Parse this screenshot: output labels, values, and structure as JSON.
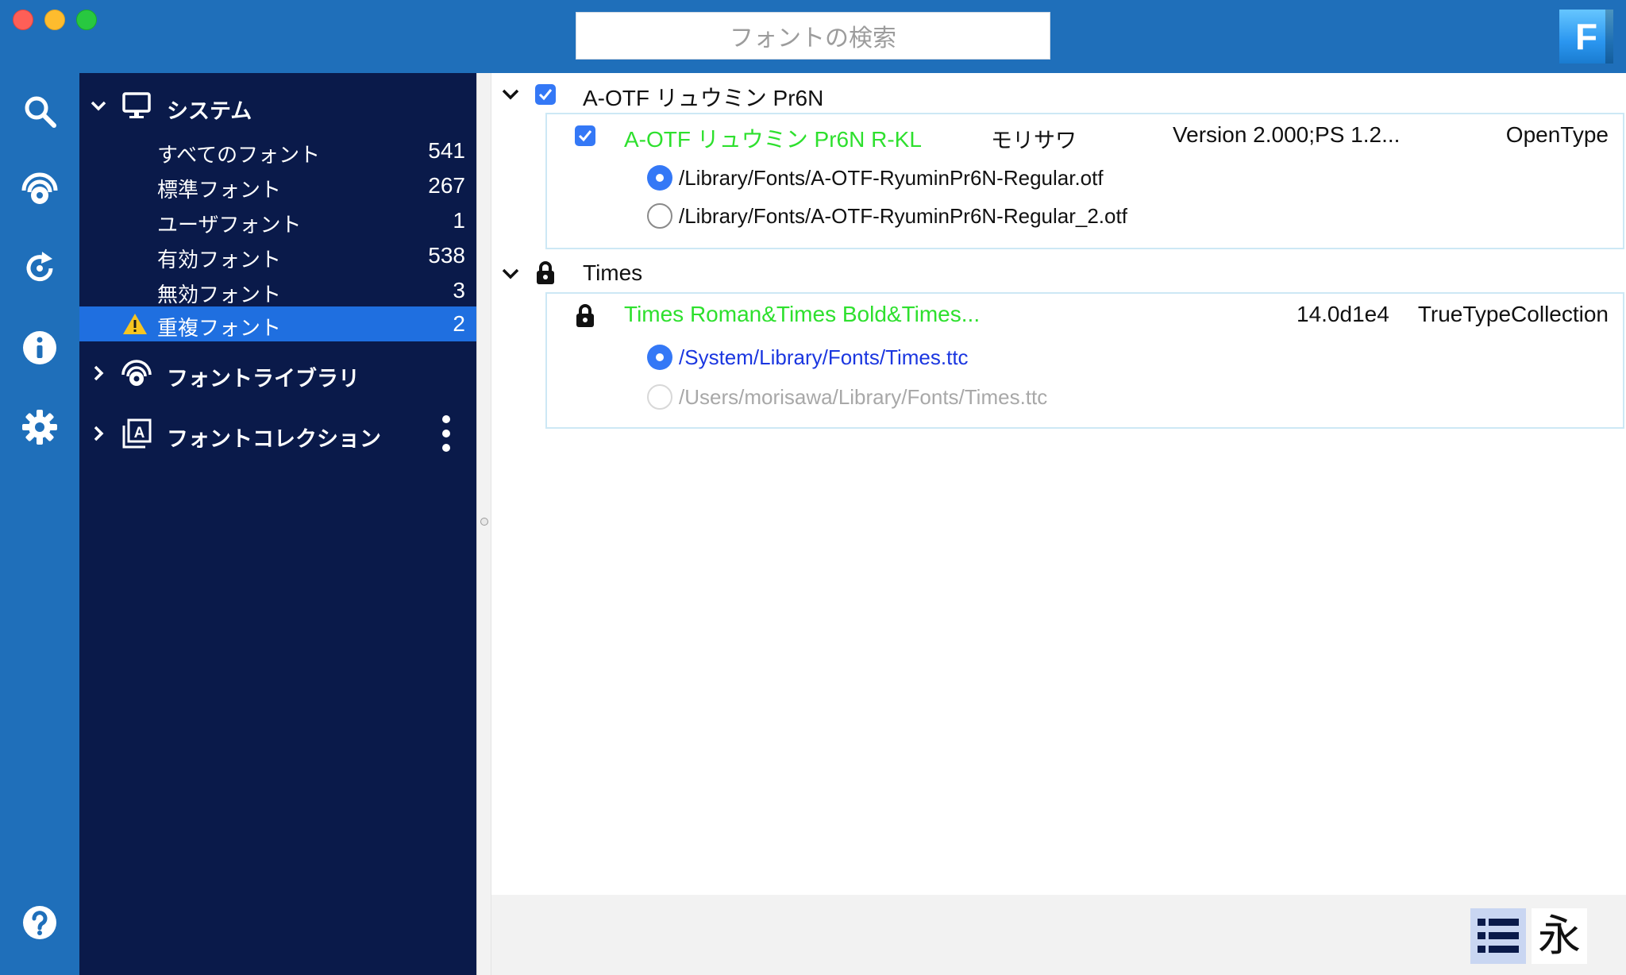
{
  "search": {
    "placeholder": "フォントの検索"
  },
  "app_logo": {
    "letter": "F"
  },
  "rail": {
    "icons": [
      "search-icon",
      "library-icon",
      "sync-icon",
      "info-icon",
      "gear-icon",
      "help-icon"
    ]
  },
  "sidebar": {
    "system": {
      "label": "システム",
      "items": [
        {
          "label": "すべてのフォント",
          "count": "541"
        },
        {
          "label": "標準フォント",
          "count": "267"
        },
        {
          "label": "ユーザフォント",
          "count": "1"
        },
        {
          "label": "有効フォント",
          "count": "538"
        },
        {
          "label": "無効フォント",
          "count": "3"
        },
        {
          "label": "重複フォント",
          "count": "2",
          "selected": true
        }
      ]
    },
    "library": {
      "label": "フォントライブラリ"
    },
    "collection": {
      "label": "フォントコレクション"
    }
  },
  "groups": [
    {
      "title": "A-OTF リュウミン Pr6N",
      "font": {
        "name": "A-OTF リュウミン Pr6N R-KL",
        "maker": "モリサワ",
        "version": "Version 2.000;PS 1.2...",
        "format": "OpenType"
      },
      "paths": [
        {
          "path": "/Library/Fonts/A-OTF-RyuminPr6N-Regular.otf",
          "state": "selected"
        },
        {
          "path": "/Library/Fonts/A-OTF-RyuminPr6N-Regular_2.otf",
          "state": "unselected"
        }
      ]
    },
    {
      "title": "Times",
      "font": {
        "name": "Times Roman&Times Bold&Times...",
        "maker": "",
        "version": "14.0d1e4",
        "format": "TrueTypeCollection"
      },
      "paths": [
        {
          "path": "/System/Library/Fonts/Times.ttc",
          "state": "selected"
        },
        {
          "path": "/Users/morisawa/Library/Fonts/Times.ttc",
          "state": "disabled"
        }
      ]
    }
  ],
  "footer": {
    "sample_glyph": "永"
  },
  "colors": {
    "titlebar": "#1f6fba",
    "sidebar": "#0a1a4a",
    "selected_row": "#1f6fe0",
    "font_name": "#2ee02e",
    "path_active": "#1a36e0",
    "path_disabled": "#a8a8a8",
    "checkbox": "#3478f6"
  }
}
